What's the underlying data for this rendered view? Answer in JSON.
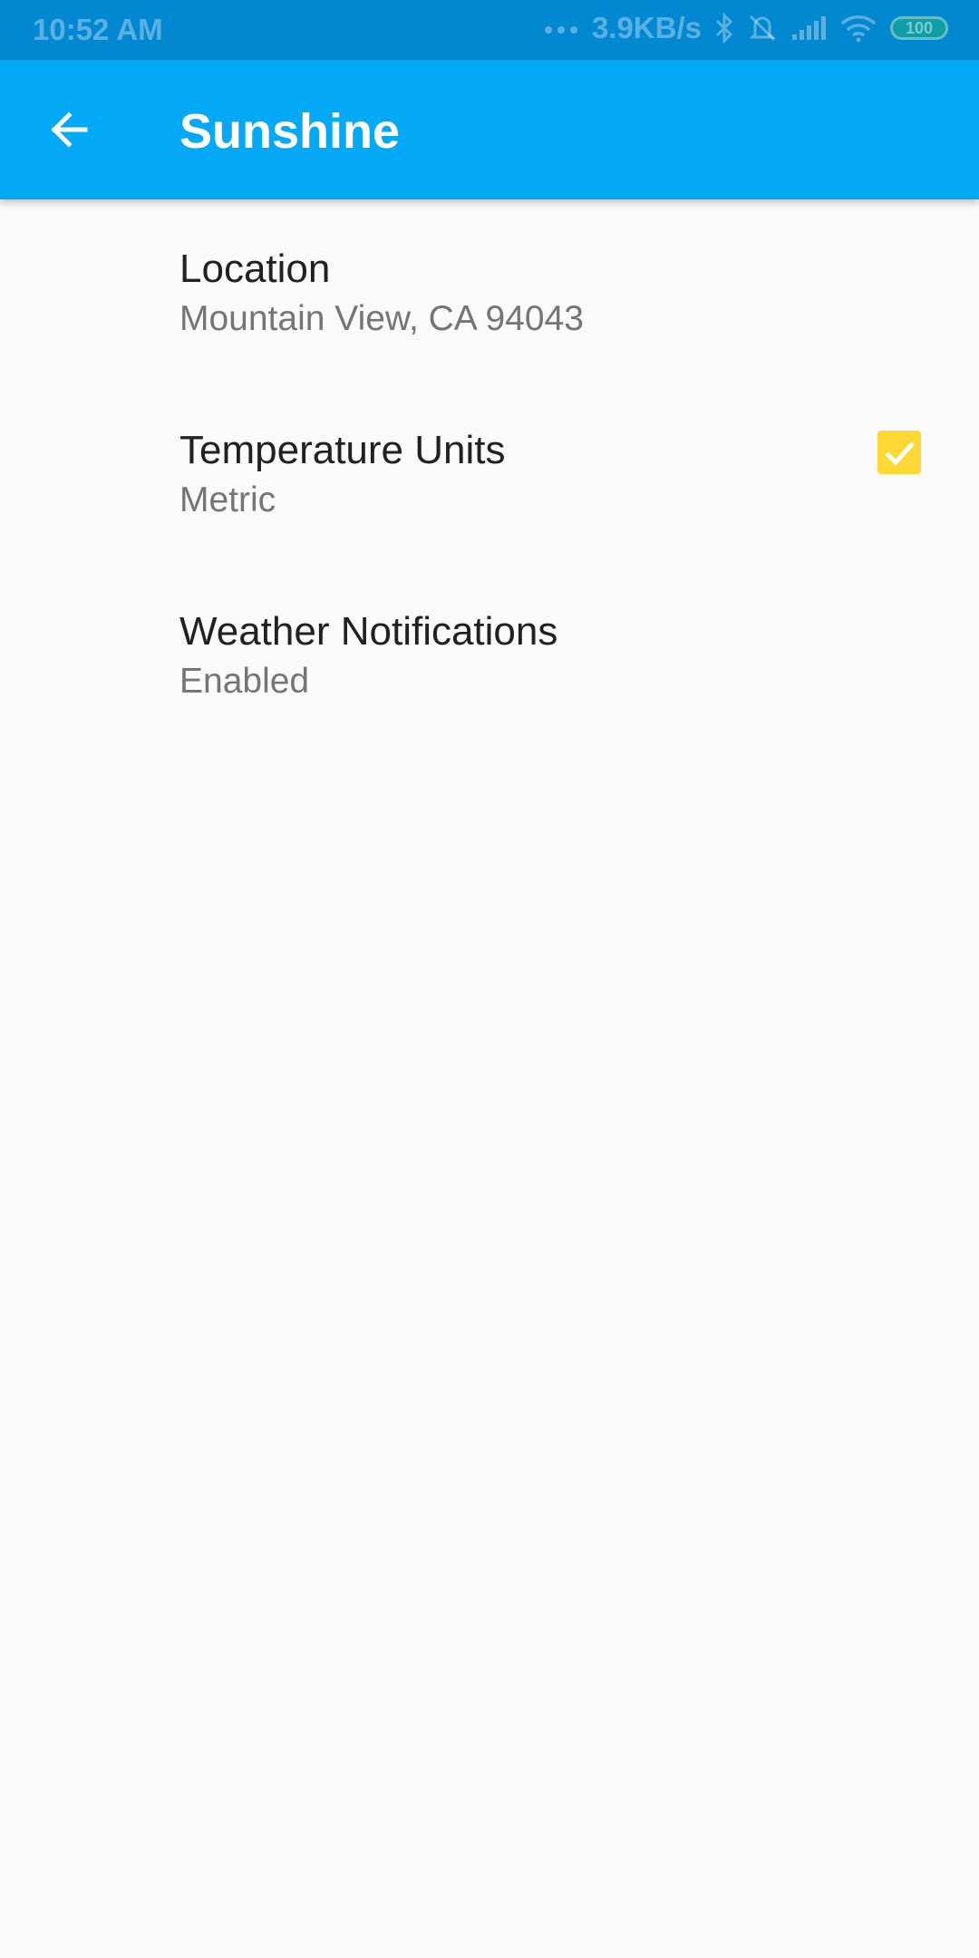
{
  "status_bar": {
    "time": "10:52 AM",
    "net_speed": "3.9KB/s",
    "battery": "100"
  },
  "app_bar": {
    "title": "Sunshine"
  },
  "preferences": [
    {
      "title": "Location",
      "summary": "Mountain View, CA 94043"
    },
    {
      "title": "Temperature Units",
      "summary": "Metric"
    },
    {
      "title": "Weather Notifications",
      "summary": "Enabled",
      "checked": true
    }
  ],
  "colors": {
    "app_bar": "#03a9f4",
    "status_bar": "#0288d1",
    "checkbox": "#fdd835"
  }
}
